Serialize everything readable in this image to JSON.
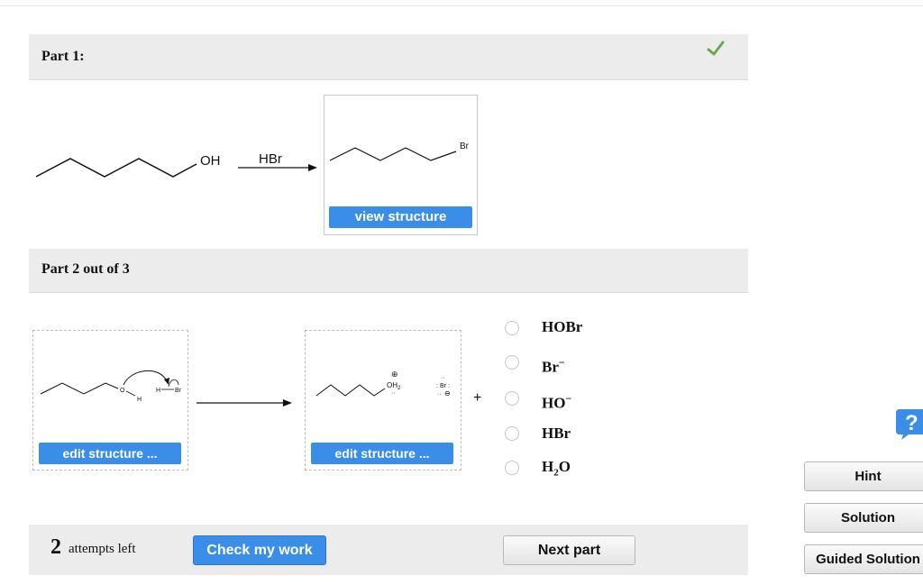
{
  "part1": {
    "title": "Part 1:",
    "reactant_group": "OH",
    "reagent": "HBr",
    "product_label": "Br",
    "view_structure_label": "view structure"
  },
  "part2": {
    "title": "Part 2 out of 3",
    "left_box": {
      "h_label": "H",
      "hbr_label": "H",
      "br_label": "Br",
      "edit_label": "edit structure ..."
    },
    "right_box": {
      "oh2_label": "OH",
      "oh2_sub": "2",
      "plus_charge": "⊕",
      "br_label": "Br",
      "minus_charge": "⊖",
      "edit_label": "edit structure ..."
    },
    "plus_sign": "+",
    "options": [
      {
        "main": "HOBr",
        "sup": "",
        "sub": "",
        "tail": ""
      },
      {
        "main": "Br",
        "sup": "−",
        "sub": "",
        "tail": ""
      },
      {
        "main": "HO",
        "sup": "−",
        "sub": "",
        "tail": ""
      },
      {
        "main": "HBr",
        "sup": "",
        "sub": "",
        "tail": ""
      },
      {
        "main": "H",
        "sup": "",
        "sub": "2",
        "tail": "O"
      }
    ]
  },
  "footer": {
    "attempts_number": "2",
    "attempts_text": "attempts left",
    "check_label": "Check my work",
    "next_label": "Next part"
  },
  "sidebar": {
    "help_icon": "question-icon",
    "hint_label": "Hint",
    "solution_label": "Solution",
    "guided_label": "Guided Solution"
  },
  "colors": {
    "accent": "#3b8ee8",
    "check": "#6aa84f",
    "panel": "#ececec"
  }
}
